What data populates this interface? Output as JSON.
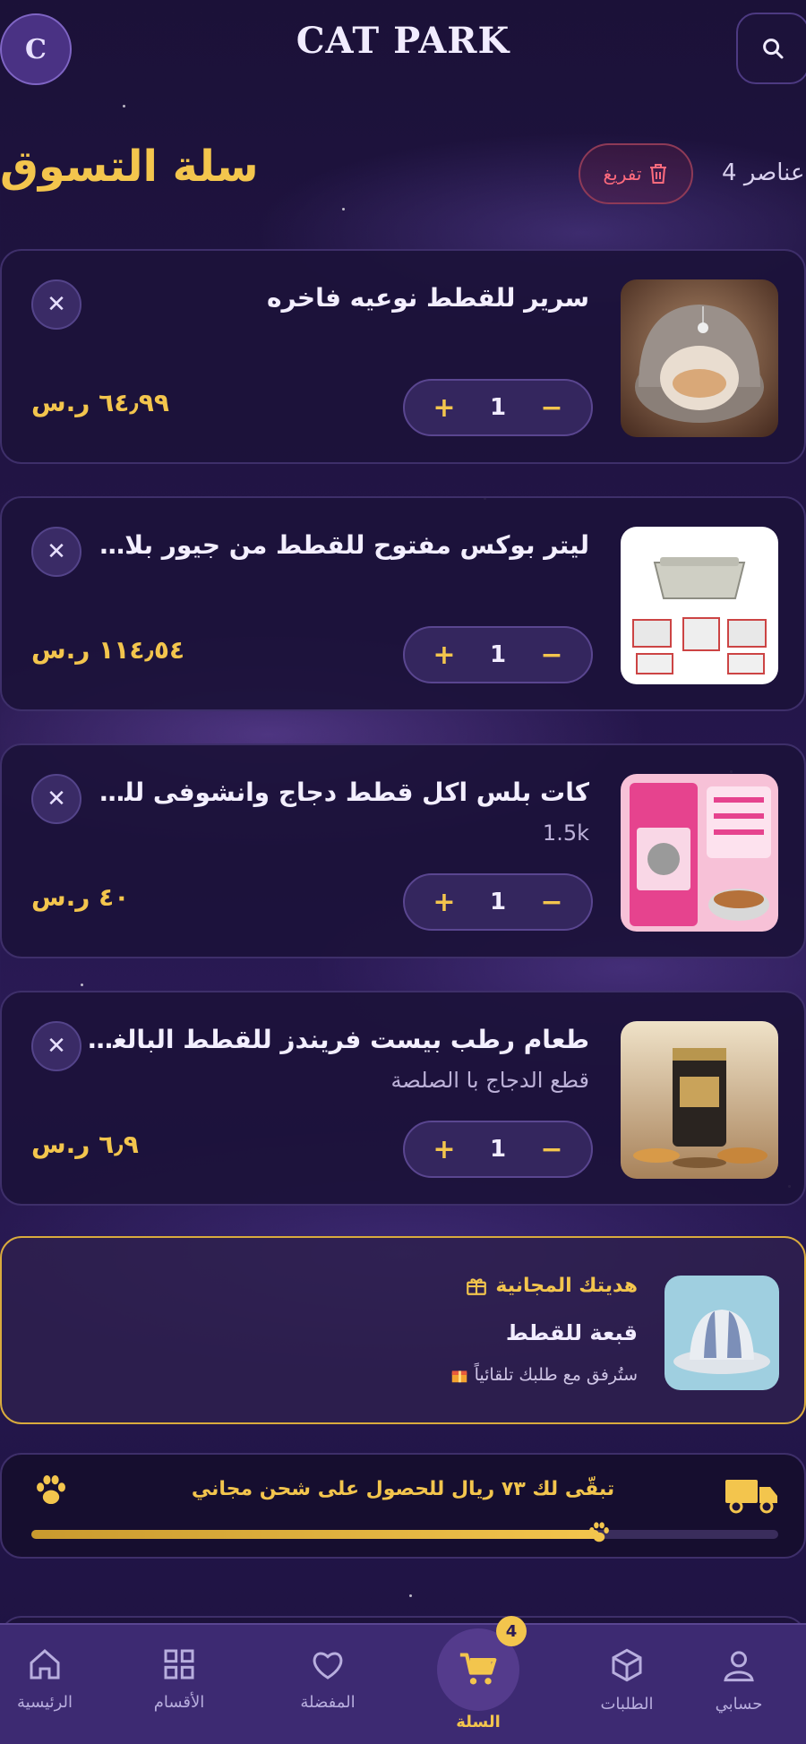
{
  "header": {
    "avatar_initial": "C",
    "brand": "CAT PARK",
    "search_icon": "search-icon"
  },
  "cart": {
    "title": "سلة التسوق",
    "clear_label": "تفريغ",
    "items_count": "4 عناصر",
    "items": [
      {
        "name": "سرير للقطط نوعيه فاخره",
        "subtitle": "",
        "quantity": "1",
        "price": "٦٤٫٩٩ ر.س"
      },
      {
        "name": "ليتر بوكس مفتوح للقطط من جيور بلاست ال...",
        "subtitle": "",
        "quantity": "1",
        "price": "١١٤٫٥٤ ر.س"
      },
      {
        "name": "كات بلس اكل قطط دجاج وانشوفى للقطط ا...",
        "subtitle": "1.5k",
        "quantity": "1",
        "price": "٤٠ ر.س"
      },
      {
        "name": "طعام رطب بيست فريندز للقطط البالغة نكها...",
        "subtitle": "قطع الدجاج با الصلصة",
        "quantity": "1",
        "price": "٦٫٩ ر.س"
      }
    ],
    "minus": "−",
    "plus": "+",
    "remove": "✕"
  },
  "gift": {
    "title": "هديتك المجانية",
    "name": "قبعة للقطط",
    "note": "ستُرفق مع طلبك تلقائياً"
  },
  "shipping": {
    "text": "تبقّى لك ٧٣ ريال للحصول على شحن مجاني",
    "progress": 0.76
  },
  "nav": {
    "home": "الرئيسية",
    "categories": "الأقسام",
    "favorites": "المفضلة",
    "cart": "السلة",
    "cart_badge": "4",
    "orders": "الطلبات",
    "account": "حسابي"
  },
  "colors": {
    "accent": "#f3c54d",
    "danger": "#ff6b7d",
    "background": "#24164a"
  }
}
